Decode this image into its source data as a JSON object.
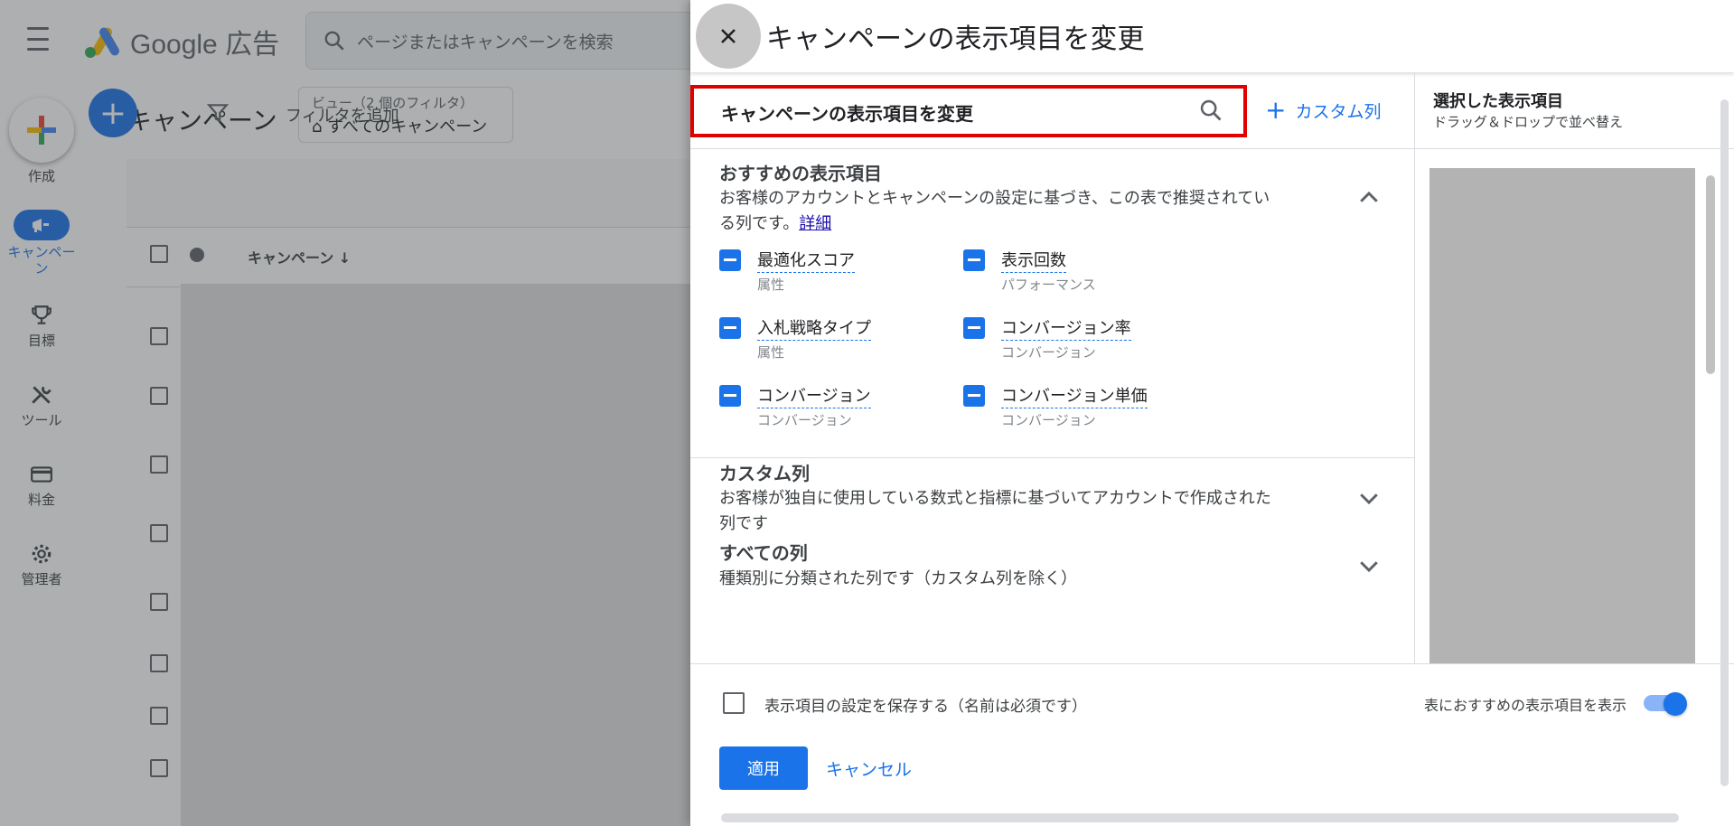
{
  "app": {
    "logo_text": "Google 広告",
    "search_placeholder": "ページまたはキャンペーンを検索",
    "create_label": "作成",
    "nav": [
      {
        "label": "キャンペーン",
        "icon": "megaphone-icon"
      },
      {
        "label": "目標",
        "icon": "trophy-icon"
      },
      {
        "label": "ツール",
        "icon": "tools-icon"
      },
      {
        "label": "料金",
        "icon": "credit-card-icon"
      },
      {
        "label": "管理者",
        "icon": "gear-icon"
      }
    ],
    "page_title": "キャンペーン",
    "view_chip": {
      "sub": "ビュー（2 個のフィルタ）",
      "main": "すべてのキャンペーン"
    },
    "filter_label": "フィルタを追加",
    "table_header_campaign": "キャンペーン ↓"
  },
  "panel": {
    "title": "キャンペーンの表示項目を変更",
    "search_value": "キャンペーンの表示項目を変更",
    "custom_column_button": "カスタム列",
    "recommended": {
      "title": "おすすめの表示項目",
      "desc_line1": "お客様のアカウントとキャンペーンの設定に基づき、この表で推奨されてい",
      "desc_line2": "る列です。",
      "detail_link": "詳細",
      "columns": [
        {
          "name": "最適化スコア",
          "category": "属性"
        },
        {
          "name": "表示回数",
          "category": "パフォーマンス"
        },
        {
          "name": "入札戦略タイプ",
          "category": "属性"
        },
        {
          "name": "コンバージョン率",
          "category": "コンバージョン"
        },
        {
          "name": "コンバージョン",
          "category": "コンバージョン"
        },
        {
          "name": "コンバージョン単価",
          "category": "コンバージョン"
        }
      ]
    },
    "custom": {
      "title": "カスタム列",
      "desc_line1": "お客様が独自に使用している数式と指標に基づいてアカウントで作成された",
      "desc_line2": "列です"
    },
    "all": {
      "title": "すべての列",
      "desc": "種類別に分類された列です（カスタム列を除く）"
    },
    "selected": {
      "title": "選択した表示項目",
      "subtitle": "ドラッグ＆ドロップで並べ替え"
    },
    "save_label": "表示項目の設定を保存する（名前は必須です）",
    "toggle_label": "表におすすめの表示項目を表示",
    "toggle_on": true,
    "apply_label": "適用",
    "cancel_label": "キャンセル"
  },
  "colors": {
    "accent": "#1a73e8",
    "highlight_border": "#e00000"
  }
}
